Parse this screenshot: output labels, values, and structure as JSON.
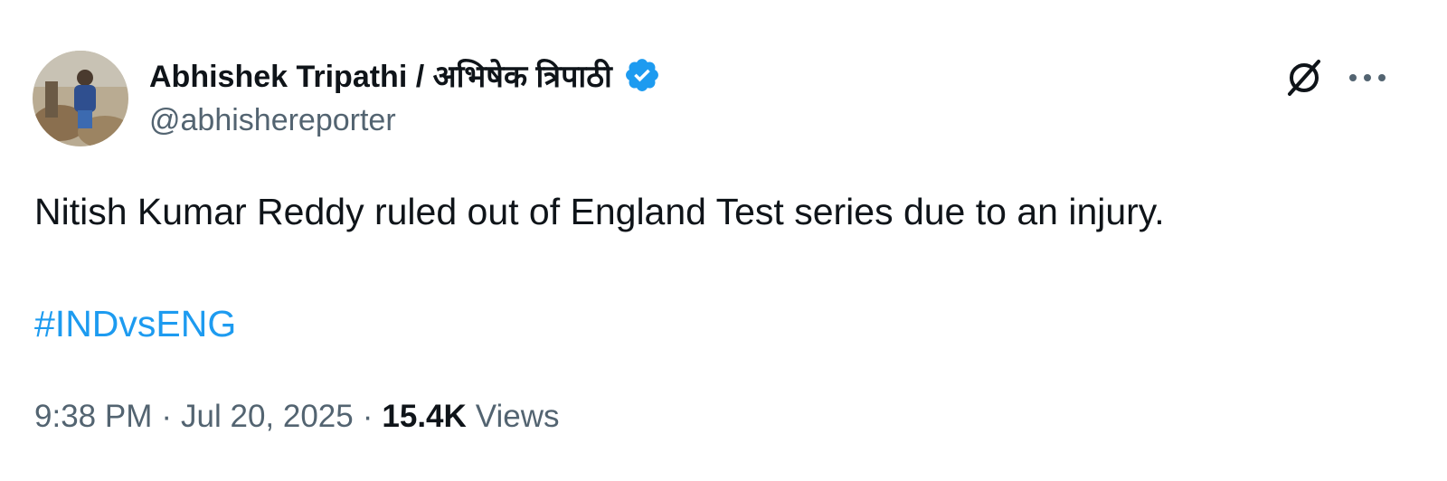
{
  "author": {
    "display_name": "Abhishek Tripathi / अभिषेक त्रिपाठी",
    "handle": "@abhishereporter",
    "verified": true
  },
  "tweet": {
    "text": "Nitish Kumar Reddy ruled out of England Test series due to an injury.",
    "hashtag": "#INDvsENG"
  },
  "meta": {
    "time": "9:38 PM",
    "separator": "·",
    "date": "Jul 20, 2025",
    "views_count": "15.4K",
    "views_label": "Views"
  },
  "icons": {
    "verified": "verified-badge-icon",
    "grok": "grok-icon",
    "more": "more-options-icon"
  },
  "colors": {
    "text": "#0f1419",
    "secondary": "#536471",
    "accent": "#1d9bf0"
  }
}
